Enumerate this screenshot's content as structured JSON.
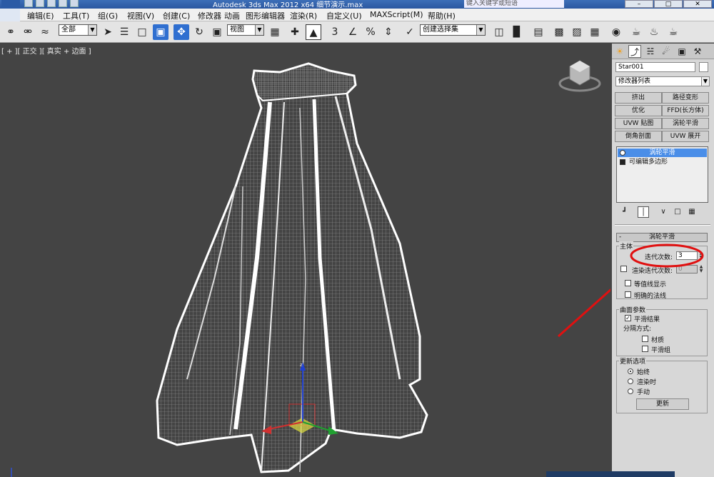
{
  "window": {
    "title": "Autodesk 3ds Max  2012 x64  细节演示.max",
    "search_placeholder": "键入关键字或短语"
  },
  "menu": [
    "编辑(E)",
    "工具(T)",
    "组(G)",
    "视图(V)",
    "创建(C)",
    "修改器",
    "动画",
    "图形编辑器",
    "渲染(R)",
    "自定义(U)",
    "MAXScript(M)",
    "帮助(H)"
  ],
  "toolbar": {
    "selection_filter": "全部",
    "reference_coord": "视图",
    "named_selection": "创建选择集",
    "snap_label": "3"
  },
  "viewport": {
    "label": "[ + ][ 正交 ][ 真实 + 边面 ]",
    "gizmo_z": "z"
  },
  "panel": {
    "object_name": "Star001",
    "modifier_list": "修改器列表",
    "modifier_buttons": [
      "挤出",
      "路径变形",
      "优化",
      "FFD(长方体)",
      "UVW 贴图",
      "涡轮平滑",
      "倒角剖面",
      "UVW 展开"
    ],
    "stack": [
      "涡轮平滑",
      "可编辑多边形"
    ],
    "rollout_title": "涡轮平滑",
    "main_group": "主体",
    "iterations_label": "迭代次数:",
    "iterations_value": "3",
    "render_iters_label": "渲染迭代次数:",
    "render_iters_value": "0",
    "isoline_label": "等值线显示",
    "explicit_normals_label": "明确的法线",
    "surface_group": "曲面参数",
    "smooth_result_label": "平滑结果",
    "separate_label": "分隔方式:",
    "material_label": "材质",
    "smoothing_groups_label": "平滑组",
    "update_group": "更新选项",
    "always_label": "始终",
    "when_rendering_label": "渲染时",
    "manual_label": "手动",
    "update_button": "更新"
  },
  "colors": {
    "accent": "#4a8ee8",
    "annotation": "#e01010",
    "viewport_bg": "#444444"
  }
}
